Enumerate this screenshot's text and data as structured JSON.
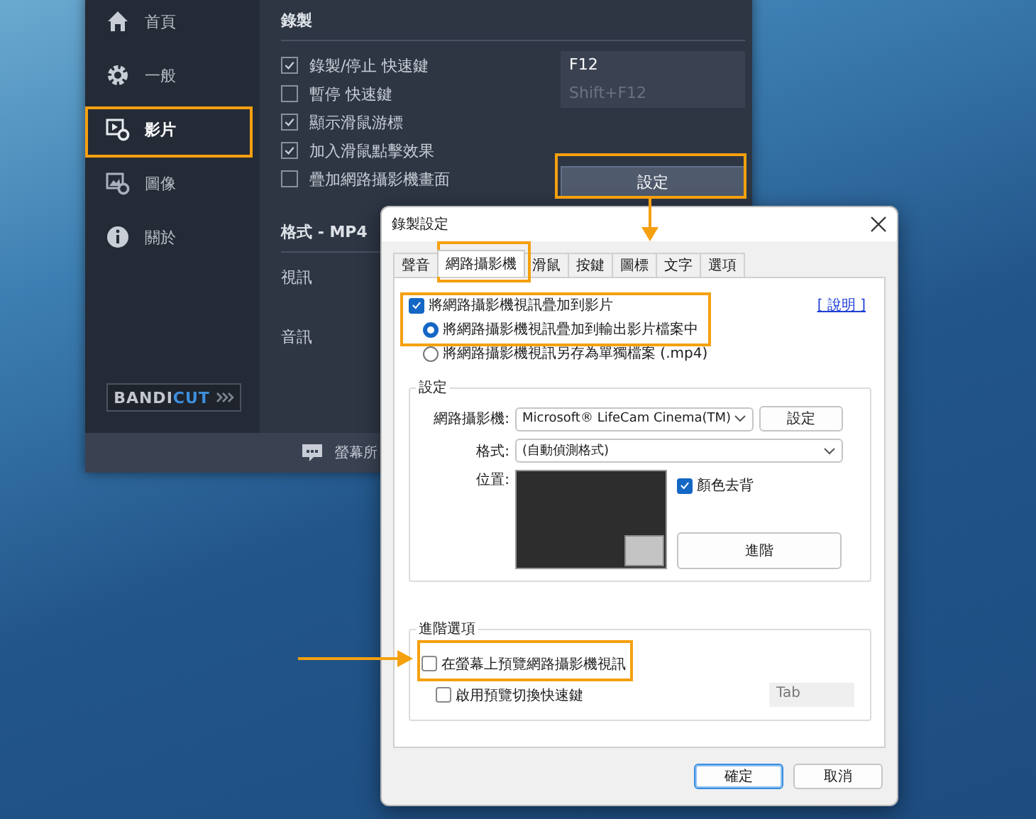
{
  "app": {
    "sidebar": [
      {
        "kind": "home",
        "label": "首頁",
        "selected": false
      },
      {
        "kind": "gear",
        "label": "一般",
        "selected": false
      },
      {
        "kind": "video",
        "label": "影片",
        "selected": true
      },
      {
        "kind": "image",
        "label": "圖像",
        "selected": false
      },
      {
        "kind": "info",
        "label": "關於",
        "selected": false
      }
    ],
    "section_title": "錄製",
    "options": [
      {
        "label": "錄製/停止 快速鍵",
        "checked": true,
        "hotkey": "F12",
        "hotkey_disabled": false
      },
      {
        "label": "暫停 快速鍵",
        "checked": false,
        "hotkey": "Shift+F12",
        "hotkey_disabled": true
      },
      {
        "label": "顯示滑鼠游標",
        "checked": true
      },
      {
        "label": "加入滑鼠點擊效果",
        "checked": true
      },
      {
        "label": "疊加網路攝影機畫面",
        "checked": false,
        "button": "設定"
      }
    ],
    "format_title": "格式 - MP4",
    "format_rows": [
      "視訊",
      "音訊"
    ],
    "logo": {
      "part_1": "BANDI",
      "part_2": "CUT"
    },
    "status": "螢幕所"
  },
  "dialog": {
    "title": "錄製設定",
    "tabs": [
      {
        "label": "聲音",
        "selected": false
      },
      {
        "label": "網路攝影機",
        "selected": true
      },
      {
        "label": "滑鼠",
        "selected": false
      },
      {
        "label": "按鍵",
        "selected": false
      },
      {
        "label": "圖標",
        "selected": false
      },
      {
        "label": "文字",
        "selected": false
      },
      {
        "label": "選項",
        "selected": false
      }
    ],
    "overlay": {
      "label": "將網路攝影機視訊疊加到影片",
      "checked": true
    },
    "help_link": "[ 說明 ]",
    "modes": [
      {
        "label": "將網路攝影機視訊疊加到輸出影片檔案中",
        "selected": true
      },
      {
        "label": "將網路攝影機視訊另存為單獨檔案 (.mp4)",
        "selected": false
      }
    ],
    "settings": {
      "title": "設定",
      "webcam_label": "網路攝影機:",
      "webcam_value": "Microsoft® LifeCam Cinema(TM)",
      "webcam_button": "設定",
      "format_label": "格式:",
      "format_value": "(自動偵測格式)",
      "position_label": "位置:",
      "chroma_key": {
        "label": "顏色去背",
        "checked": true
      },
      "advanced_button": "進階"
    },
    "advanced": {
      "title": "進階選項",
      "options": [
        {
          "label": "在螢幕上預覽網路攝影機視訊",
          "checked": false
        },
        {
          "label": "啟用預覽切換快速鍵",
          "checked": false,
          "hotkey": "Tab"
        }
      ]
    },
    "buttons": [
      {
        "label": "確定",
        "default": true
      },
      {
        "label": "取消",
        "default": false
      }
    ]
  }
}
